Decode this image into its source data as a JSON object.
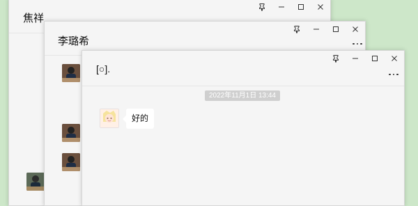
{
  "windows": [
    {
      "id": "jiaoxiang",
      "title": "焦祥"
    },
    {
      "id": "lilixi",
      "title": "李璐希"
    },
    {
      "id": "chat3",
      "title": "[○].",
      "timestamp": "2022年11月1日 13:44",
      "messages": [
        {
          "from": "contact",
          "text": "好的"
        }
      ]
    }
  ],
  "icons": {
    "pin": "pin-icon",
    "minimize": "minimize-icon",
    "maximize": "maximize-icon",
    "close": "close-icon",
    "more": "more-icon"
  },
  "colors": {
    "desktop_bg": "#cde7c9",
    "window_bg": "#f5f5f5",
    "bubble_bg": "#ffffff",
    "timestamp_bg": "#cfcfcf"
  }
}
